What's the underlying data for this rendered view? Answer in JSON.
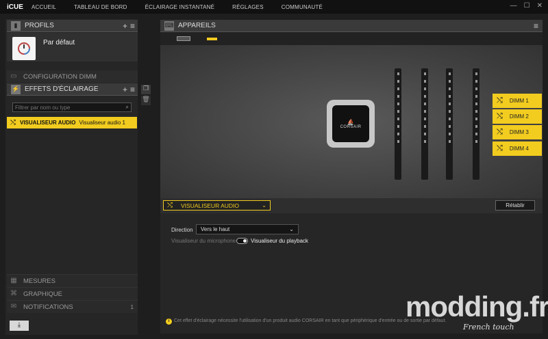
{
  "app": {
    "logo": "iCUE",
    "nav": [
      "ACCUEIL",
      "TABLEAU DE BORD",
      "ÉCLAIRAGE INSTANTANÉ",
      "RÉGLAGES",
      "COMMUNAUTÉ"
    ],
    "win_min": "—",
    "win_max": "☐",
    "win_close": "✕"
  },
  "profiles": {
    "title": "PROFILS",
    "add": "+",
    "menu": "≡",
    "item": "Par défaut"
  },
  "sidebar": {
    "dimm_config": "CONFIGURATION DIMM",
    "effects_title": "EFFETS D'ÉCLAIRAGE",
    "effects_add": "+",
    "effects_menu": "≡",
    "filter_placeholder": "Filtrer par nom ou type",
    "effect_type": "VISUALISEUR AUDIO",
    "effect_name": "Visualiseur audio 1",
    "mesures": "MESURES",
    "graphique": "GRAPHIQUE",
    "notifications": "NOTIFICATIONS",
    "notifications_count": "1"
  },
  "devices": {
    "title": "APPAREILS",
    "cooler_brand": "CORSAIR",
    "dimms": [
      "DIMM 1",
      "DIMM 2",
      "DIMM 3",
      "DIMM 4"
    ]
  },
  "effect": {
    "selected": "VISUALISEUR AUDIO",
    "reset": "Rétablir",
    "direction_label": "Direction",
    "direction_value": "Vers le haut",
    "toggle_off": "Visualiseur du microphone",
    "toggle_on": "Visualiseur du playback",
    "notice": "Cet effet d'éclairage nécessite l'utilisation d'un produit audio CORSAIR en tant que périphérique d'entrée ou de sortie par défaut."
  },
  "watermark": {
    "main": "modding.fr",
    "sub": "French touch"
  },
  "colors": {
    "accent": "#f2cc1f",
    "panel": "#2a2a2a",
    "header": "#3a3a3a"
  }
}
